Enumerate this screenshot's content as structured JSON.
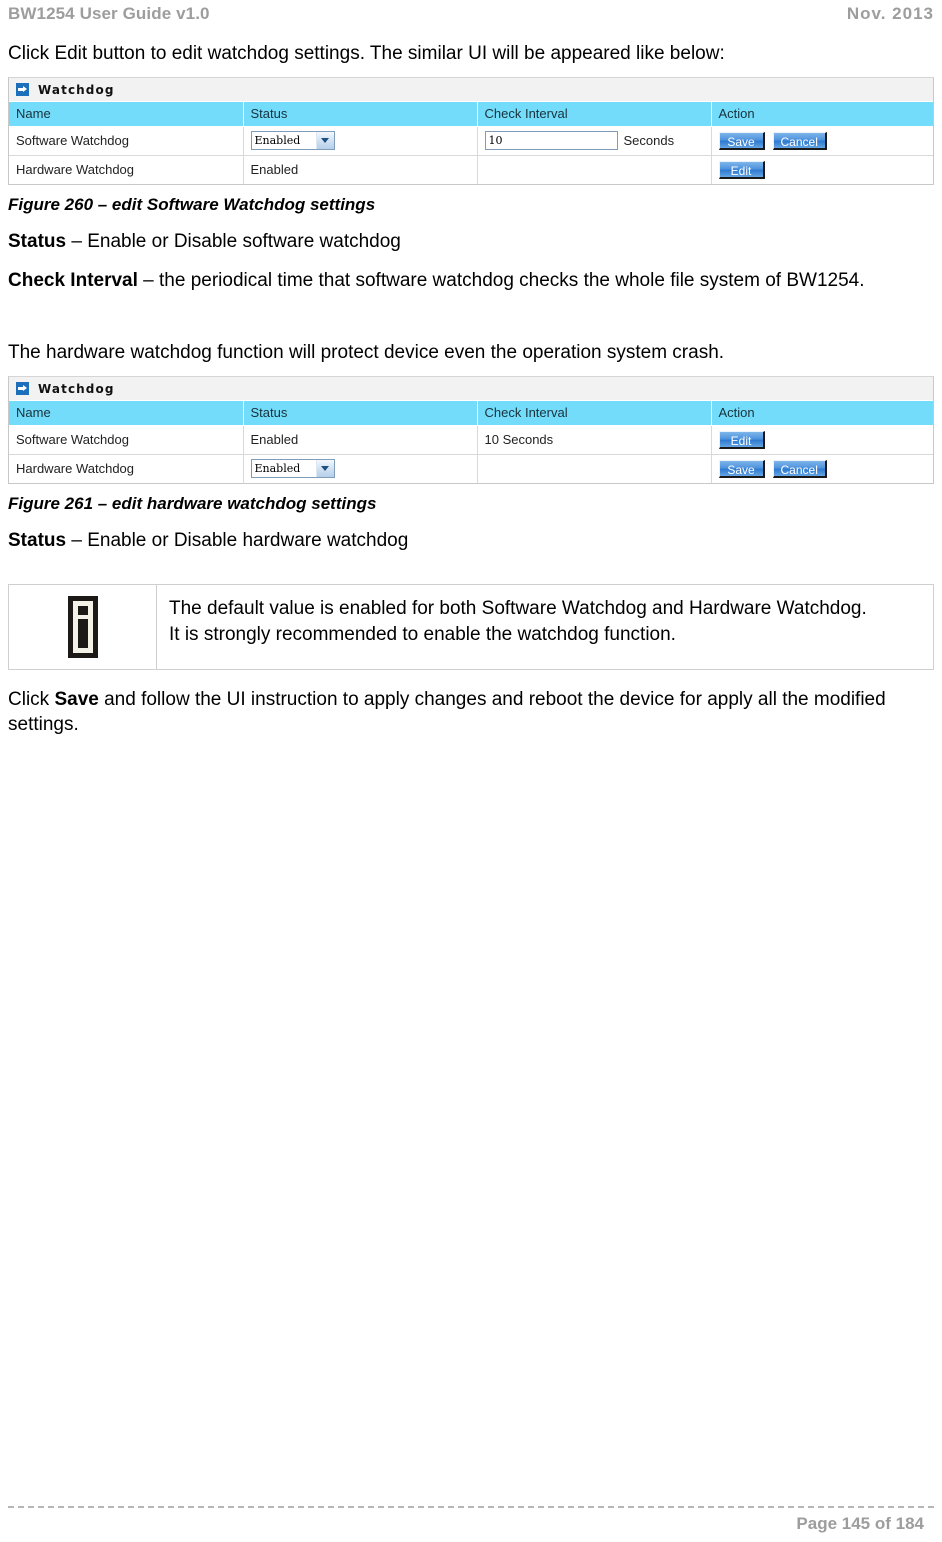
{
  "header": {
    "left": "BW1254 User Guide v1.0",
    "right": "Nov.  2013"
  },
  "intro_paragraph": "Click Edit button to edit watchdog settings. The similar UI will be appeared like below:",
  "panel_title": "Watchdog",
  "columns": {
    "name": "Name",
    "status": "Status",
    "check_interval": "Check Interval",
    "action": "Action"
  },
  "labels": {
    "software_watchdog": "Software Watchdog",
    "hardware_watchdog": "Hardware Watchdog",
    "enabled": "Enabled",
    "seconds_unit": "Seconds",
    "interval_value": "10",
    "interval_display": "10 Seconds",
    "save": "Save",
    "cancel": "Cancel",
    "edit": "Edit"
  },
  "figure260": {
    "caption": "Figure 260 – edit Software Watchdog settings",
    "status_term": "Status",
    "status_desc": " – Enable or Disable software watchdog",
    "interval_term": "Check Interval",
    "interval_desc": " – the periodical time that software watchdog checks the whole file system of BW1254."
  },
  "hardware_intro": "The hardware watchdog function will protect device even the operation system crash.",
  "figure261": {
    "caption": "Figure 261 – edit hardware watchdog settings",
    "status_term": "Status",
    "status_desc": " – Enable or Disable hardware watchdog"
  },
  "note": {
    "icon": "info-icon",
    "line1": "The default value is enabled for both Software Watchdog and Hardware Watchdog.",
    "line2": "It is strongly recommended to enable the watchdog function."
  },
  "closing": {
    "prefix": "Click ",
    "bold": "Save",
    "suffix": " and follow the UI instruction to apply changes and reboot the device for apply all the modified settings."
  },
  "footer": {
    "page": "Page 145 of 184"
  }
}
